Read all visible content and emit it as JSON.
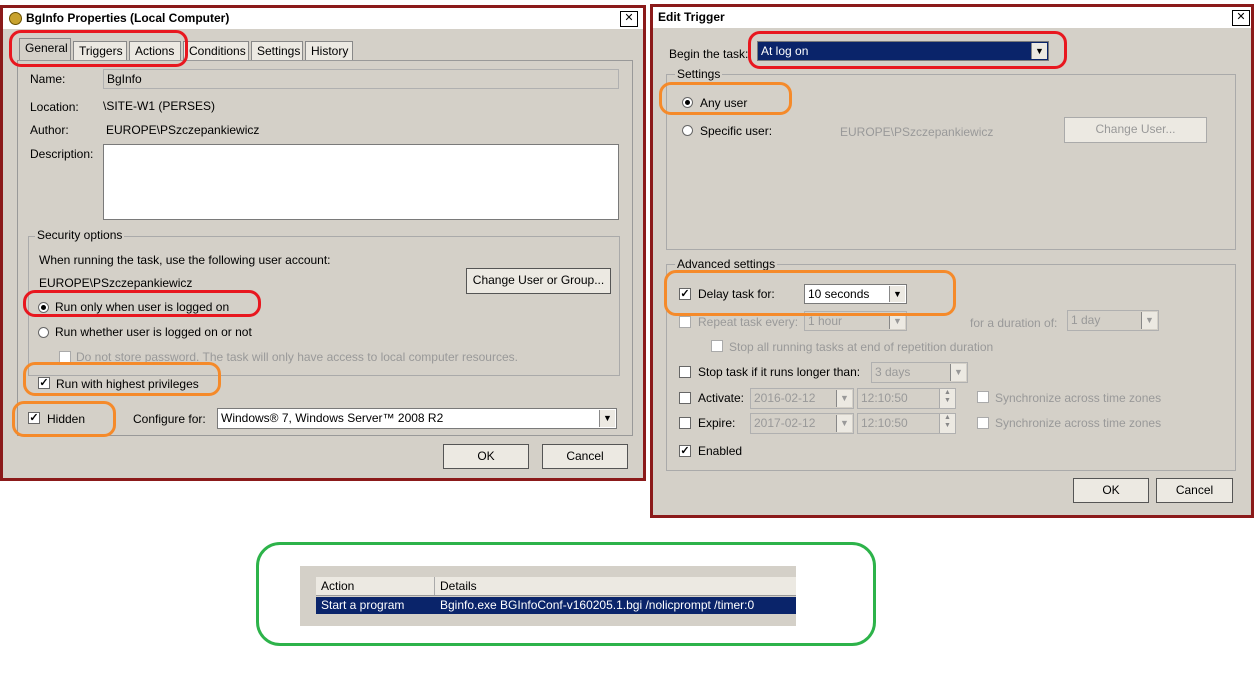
{
  "left_dialog": {
    "title": "BgInfo Properties (Local Computer)",
    "close": "✕",
    "tabs": [
      "General",
      "Triggers",
      "Actions",
      "Conditions",
      "Settings",
      "History"
    ],
    "name_label": "Name:",
    "name_value": "BgInfo",
    "location_label": "Location:",
    "location_value": "\\SITE-W1 (PERSES)",
    "author_label": "Author:",
    "author_value": "EUROPE\\PSzczepankiewicz",
    "description_label": "Description:",
    "description_value": "",
    "security_group_label": "Security options",
    "account_prompt": "When running the task, use the following user account:",
    "account_value": "EUROPE\\PSzczepankiewicz",
    "change_user_button": "Change User or Group...",
    "radio_logged_on": "Run only when user is logged on",
    "radio_whether": "Run whether user is logged on or not",
    "no_store_password": "Do not store password.  The task will only have access to local computer resources.",
    "highest_privileges": "Run with highest privileges",
    "hidden": "Hidden",
    "configure_label": "Configure for:",
    "configure_value": "Windows® 7, Windows Server™ 2008 R2",
    "ok": "OK",
    "cancel": "Cancel"
  },
  "right_dialog": {
    "title": "Edit Trigger",
    "close": "✕",
    "begin_label": "Begin the task:",
    "begin_value": "At log on",
    "settings_group": "Settings",
    "any_user": "Any user",
    "specific_user": "Specific user:",
    "specific_user_value": "EUROPE\\PSzczepankiewicz",
    "change_user_button": "Change User...",
    "advanced_group": "Advanced settings",
    "delay_label": "Delay task for:",
    "delay_value": "10 seconds",
    "repeat_label": "Repeat task every:",
    "repeat_value": "1 hour",
    "duration_label": "for a duration of:",
    "duration_value": "1 day",
    "stop_all": "Stop all running tasks at end of repetition duration",
    "stop_longer": "Stop task if it runs longer than:",
    "stop_longer_value": "3 days",
    "activate_label": "Activate:",
    "activate_date": "2016-02-12",
    "activate_time": "12:10:50",
    "expire_label": "Expire:",
    "expire_date": "2017-02-12",
    "expire_time": "12:10:50",
    "sync_tz": "Synchronize across time zones",
    "enabled": "Enabled",
    "ok": "OK",
    "cancel": "Cancel"
  },
  "action_table": {
    "headers": [
      "Action",
      "Details"
    ],
    "row": [
      "Start a program",
      "Bginfo.exe BGInfoConf-v160205.1.bgi /nolicprompt /timer:0"
    ]
  },
  "colors": {
    "frame": "#8b1a1a",
    "highlight_red": "#e8171f",
    "highlight_orange": "#f58a2a",
    "highlight_green": "#2db34a",
    "selection": "#0a246a"
  }
}
